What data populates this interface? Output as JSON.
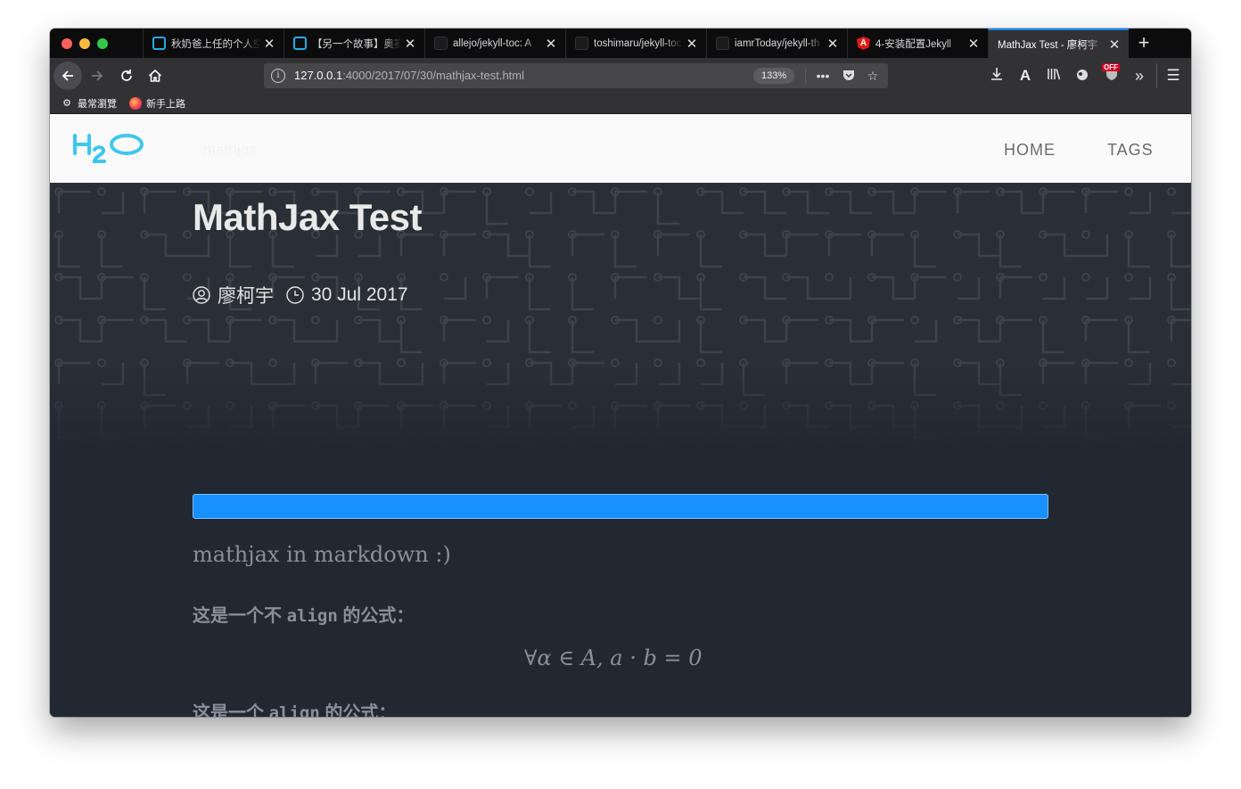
{
  "browser": {
    "tabs": [
      {
        "title": "秋奶爸上任的个人空",
        "favicon": "bilibili-icon",
        "active": false
      },
      {
        "title": "【另一个故事】奥赛",
        "favicon": "bilibili-icon",
        "active": false
      },
      {
        "title": "allejo/jekyll-toc: A",
        "favicon": "github-icon",
        "active": false
      },
      {
        "title": "toshimaru/jekyll-toc",
        "favicon": "github-icon",
        "active": false
      },
      {
        "title": "iamrToday/jekyll-th",
        "favicon": "github-icon",
        "active": false
      },
      {
        "title": "4-安装配置Jekyll",
        "favicon": "angular-icon",
        "active": false
      },
      {
        "title": "MathJax Test - 廖柯宇",
        "favicon": "none",
        "active": true
      }
    ],
    "url": {
      "host": "127.0.0.1",
      "rest": ":4000/2017/07/30/mathjax-test.html"
    },
    "zoom": "133%",
    "off_badge": "OFF",
    "bookmarks": [
      {
        "label": "最常瀏覽",
        "icon": "gear-icon"
      },
      {
        "label": "新手上路",
        "icon": "firefox-icon"
      }
    ],
    "accent": "#0a84ff"
  },
  "site": {
    "logo_text": "H2O",
    "subtitle": "mathjax",
    "nav": {
      "home": "HOME",
      "tags": "TAGS"
    },
    "accent": "#3ec7ee"
  },
  "post": {
    "title": "MathJax Test",
    "author": "廖柯宇",
    "date": "30 Jul 2017",
    "intro": "mathjax in markdown :)",
    "para1_pre": "这是一个不 ",
    "para1_code": "align",
    "para1_post": " 的公式：",
    "formula": "∀α ∈ A,    a · b = 0",
    "para2_pre": "这是一个 ",
    "para2_code": "align",
    "para2_post": " 的公式：",
    "progress": 1.0,
    "progress_color": "#1890ff"
  }
}
